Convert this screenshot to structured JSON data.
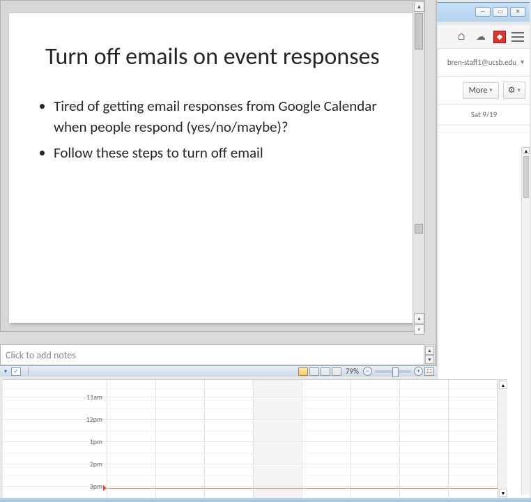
{
  "slide": {
    "title": "Turn off emails on event responses",
    "bullets": [
      "Tired of getting email responses from Google Calendar when people respond (yes/no/maybe)?",
      "Follow these steps to turn off email"
    ]
  },
  "notes": {
    "placeholder": "Click to add notes"
  },
  "status": {
    "zoom": "79%"
  },
  "browser": {
    "user_email": "bren-staff1@ucsb.edu",
    "more_label": "More"
  },
  "calendar": {
    "day_label": "Sat 9/19",
    "hours": [
      "11am",
      "12pm",
      "1pm",
      "2pm",
      "3pm"
    ]
  }
}
